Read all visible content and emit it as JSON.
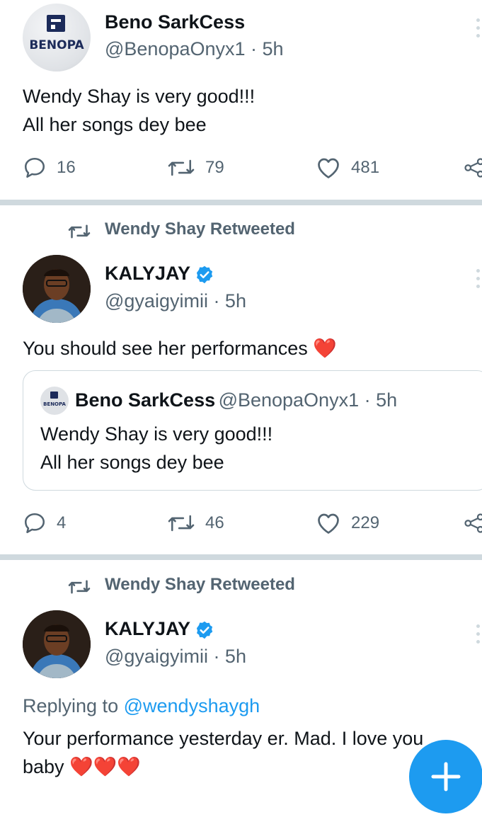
{
  "tweet1": {
    "name": "Beno SarkCess",
    "handle": "@BenopaOnyx1 · 5h",
    "logo_text": "BENOPA",
    "text_line1": "Wendy Shay is very good!!!",
    "text_line2": "All her songs dey bee",
    "replies": "16",
    "retweets": "79",
    "likes": "481"
  },
  "tweet2": {
    "retweeted_by": "Wendy Shay Retweeted",
    "name": "KALYJAY",
    "handle": "@gyaigyimii · 5h",
    "text": "You should see her performances",
    "emoji": "❤️",
    "quote": {
      "name": "Beno SarkCess",
      "handle": "@BenopaOnyx1 · 5h",
      "logo_text": "BENOPA",
      "text_line1": "Wendy Shay is very good!!!",
      "text_line2": "All her songs dey bee"
    },
    "replies": "4",
    "retweets": "46",
    "likes": "229"
  },
  "tweet3": {
    "retweeted_by": "Wendy Shay Retweeted",
    "name": "KALYJAY",
    "handle": "@gyaigyimii · 5h",
    "replying_prefix": "Replying to",
    "replying_to": "@wendyshaygh",
    "text_line1": "Your performance yesterday er. Mad. I love you",
    "text_line2_prefix": "baby",
    "emoji": "❤️❤️❤️"
  },
  "colors": {
    "accent": "#1d9bf0",
    "secondary_text": "#536471",
    "divider": "#cfd9de",
    "heart": "#e0245e",
    "verified": "#1d9bf0"
  },
  "icons": {
    "reply": "comment-bubble-icon",
    "retweet": "retweet-arrows-icon",
    "like": "heart-outline-icon",
    "share": "share-icon",
    "more": "more-options-icon",
    "verified": "verified-badge-icon",
    "compose": "compose-tweet-icon"
  }
}
